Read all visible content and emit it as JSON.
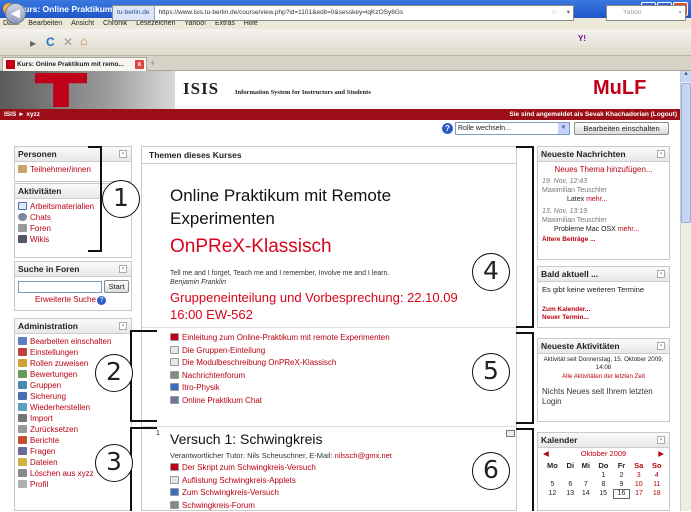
{
  "window": {
    "title": "Kurs: Online Praktikum mit remote Experimenten OnPReX-klassisch - Mozilla Firefox"
  },
  "menu": [
    "Datei",
    "Bearbeiten",
    "Ansicht",
    "Chronik",
    "Lesezeichen",
    "Yahoo!",
    "Extras",
    "Hilfe"
  ],
  "nav": {
    "site": "tu-berlin.de",
    "url": "https://www.isis.tu-berlin.de/course/view.php?id=1101&edit=0&sesskey=lqKzOSy6Gs",
    "search_placeholder": "Yahoo",
    "search_brand": "Y!"
  },
  "tab": {
    "label": "Kurs: Online Praktikum mit remo..."
  },
  "header": {
    "isis": "ISIS",
    "isis_sub": "Information System for Instructors and Students",
    "mulf": "MuLF",
    "breadcrumb": "ISIS ► xyzz",
    "login": "Sie sind angemeldet als Sevak Khachadorian (Logout)"
  },
  "rolebar": {
    "role_select": "Rolle wechseln...",
    "edit_button": "Bearbeiten einschalten"
  },
  "left": {
    "personen": {
      "title": "Personen",
      "items": [
        "Teilnehmer/innen"
      ]
    },
    "aktivitaeten": {
      "title": "Aktivitäten",
      "items": [
        "Arbeitsmaterialien",
        "Chats",
        "Foren",
        "Wikis"
      ]
    },
    "suche": {
      "title": "Suche in Foren",
      "button": "Start",
      "advanced": "Erweiterte Suche"
    },
    "admin": {
      "title": "Administration",
      "items": [
        "Bearbeiten einschalten",
        "Einstellungen",
        "Rollen zuweisen",
        "Bewertungen",
        "Gruppen",
        "Sicherung",
        "Wiederherstellen",
        "Import",
        "Zurücksetzen",
        "Berichte",
        "Fragen",
        "Dateien",
        "Löschen aus xyzz",
        "Profil"
      ]
    }
  },
  "main": {
    "header": "Themen dieses Kurses",
    "title": "Online Praktikum mit Remote Experimenten",
    "subtitle": "OnPReX-Klassisch",
    "quote": "Tell me and I forget, Teach me and I remember, Involve me and I learn.",
    "quote_author": "Benjamin Franklin",
    "announcement": "Gruppeneinteilung und Vorbesprechung: 22.10.09 16:00 EW-562",
    "resources": [
      "Einleitung zum Online-Praktikum mit remote Experimenten",
      "Die Gruppen-Einteilung",
      "Die Modulbeschreibung OnPReX-Klassisch",
      "Nachrichtenforum",
      "Itro-Physik",
      "Online Praktikum Chat"
    ],
    "section1": {
      "number": "1",
      "title": "Versuch 1: Schwingkreis",
      "tutor": "Verantwortlicher Tutor: Nils Scheuschner, E-Mail:",
      "email": "nilssch@gmx.net",
      "items": [
        "Der Skript zum Schwingkreis-Versuch",
        "Auflistung Schwingkreis-Applets",
        "Zum Schwingkreis-Versuch",
        "Schwingkreis-Forum"
      ]
    }
  },
  "right": {
    "news": {
      "title": "Neueste Nachrichten",
      "add": "Neues Thema hinzufügen...",
      "posts": [
        {
          "date": "19. Nov, 12:43",
          "author": "Maximilian Teuschler",
          "text": "Latex",
          "more": "mehr..."
        },
        {
          "date": "13. Nov, 13:19",
          "author": "Maximilian Teuschler",
          "text": "Probleme Mac OSX",
          "more": "mehr..."
        }
      ],
      "older": "Ältere Beiträge ..."
    },
    "upcoming": {
      "title": "Bald aktuell ...",
      "text": "Es gibt keine weiteren Termine",
      "calendar": "Zum Kalender...",
      "new": "Neuer Termin..."
    },
    "recent": {
      "title": "Neueste Aktivitäten",
      "since": "Aktivität seit Donnerstag, 15. Oktober 2009, 14:08",
      "all": "Alle Aktivitäten der letzten Zeit",
      "none": "Nichts Neues seit Ihrem letzten Login"
    },
    "calendar": {
      "title": "Kalender",
      "month": "Oktober 2009",
      "days": [
        "Mo",
        "Di",
        "Mi",
        "Do",
        "Fr",
        "Sa",
        "So"
      ],
      "rows": [
        [
          "",
          "",
          "",
          "1",
          "2",
          "3",
          "4"
        ],
        [
          "5",
          "6",
          "7",
          "8",
          "9",
          "10",
          "11"
        ],
        [
          "12",
          "13",
          "14",
          "15",
          "16",
          "17",
          "18"
        ]
      ]
    }
  },
  "annotations": [
    "1",
    "2",
    "3",
    "4",
    "5",
    "6"
  ],
  "colors": {
    "accent_red": "#b00011",
    "header_bar": "#9b0e18",
    "titlebar": "#2458cc"
  }
}
